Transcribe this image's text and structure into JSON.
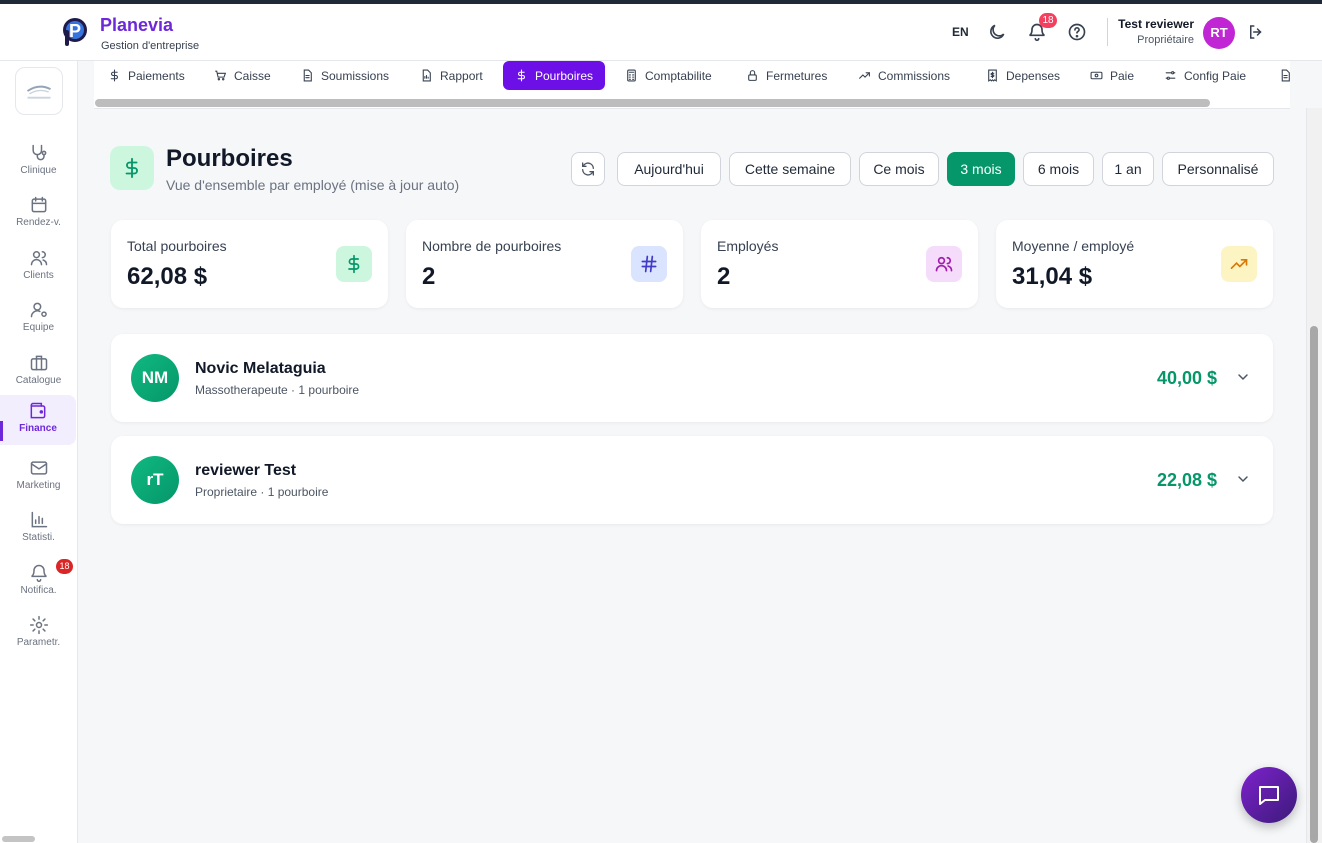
{
  "brand": {
    "title": "Planevia",
    "subtitle": "Gestion d'entreprise"
  },
  "header": {
    "language": "EN",
    "notification_count": "18",
    "user_name": "Test reviewer",
    "user_role": "Propriétaire",
    "user_initials": "RT"
  },
  "sidebar": {
    "items": [
      {
        "label": "Clinique",
        "icon": "stethoscope-icon"
      },
      {
        "label": "Rendez-v.",
        "icon": "calendar-icon"
      },
      {
        "label": "Clients",
        "icon": "users-icon"
      },
      {
        "label": "Equipe",
        "icon": "user-cog-icon"
      },
      {
        "label": "Catalogue",
        "icon": "briefcase-icon"
      },
      {
        "label": "Finance",
        "icon": "wallet-icon",
        "active": true
      },
      {
        "label": "Marketing",
        "icon": "mail-icon"
      },
      {
        "label": "Statisti.",
        "icon": "bar-chart-icon"
      },
      {
        "label": "Notifica.",
        "icon": "bell-icon",
        "badge": "18"
      },
      {
        "label": "Parametr.",
        "icon": "gear-icon"
      }
    ]
  },
  "tabs": [
    {
      "label": "Paiements",
      "icon": "dollar-icon"
    },
    {
      "label": "Caisse",
      "icon": "cart-icon"
    },
    {
      "label": "Soumissions",
      "icon": "file-icon"
    },
    {
      "label": "Rapport",
      "icon": "file-chart-icon"
    },
    {
      "label": "Pourboires",
      "icon": "dollar-icon",
      "active": true
    },
    {
      "label": "Comptabilite",
      "icon": "calculator-icon"
    },
    {
      "label": "Fermetures",
      "icon": "lock-icon"
    },
    {
      "label": "Commissions",
      "icon": "trending-up-icon"
    },
    {
      "label": "Depenses",
      "icon": "receipt-icon"
    },
    {
      "label": "Paie",
      "icon": "banknote-icon"
    },
    {
      "label": "Config Paie",
      "icon": "settings-sliders-icon"
    }
  ],
  "page": {
    "title": "Pourboires",
    "subtitle": "Vue d'ensemble par employé (mise à jour auto)"
  },
  "periods": [
    {
      "label": "Aujourd'hui"
    },
    {
      "label": "Cette semaine"
    },
    {
      "label": "Ce mois"
    },
    {
      "label": "3 mois",
      "active": true
    },
    {
      "label": "6 mois"
    },
    {
      "label": "1 an"
    },
    {
      "label": "Personnalisé"
    }
  ],
  "stats": [
    {
      "label": "Total pourboires",
      "value": "62,08 $",
      "icon": "dollar-icon",
      "bg": "#cdf6df",
      "fg": "#059669"
    },
    {
      "label": "Nombre de pourboires",
      "value": "2",
      "icon": "hash-icon",
      "bg": "#dbe4fe",
      "fg": "#4338ca"
    },
    {
      "label": "Employés",
      "value": "2",
      "icon": "users-icon",
      "bg": "#f5dcfb",
      "fg": "#a21caf"
    },
    {
      "label": "Moyenne / employé",
      "value": "31,04 $",
      "icon": "trending-up-icon",
      "bg": "#fdf4c3",
      "fg": "#d97706"
    }
  ],
  "employees": [
    {
      "initials": "NM",
      "name": "Novic Melataguia",
      "meta": "Massotherapeute · 1 pourboire",
      "amount": "40,00 $"
    },
    {
      "initials": "rT",
      "name": "reviewer Test",
      "meta": "Proprietaire · 1 pourboire",
      "amount": "22,08 $"
    }
  ],
  "colors": {
    "accent": "#6d10e8",
    "success": "#059669",
    "brand": "#6d28d9"
  }
}
